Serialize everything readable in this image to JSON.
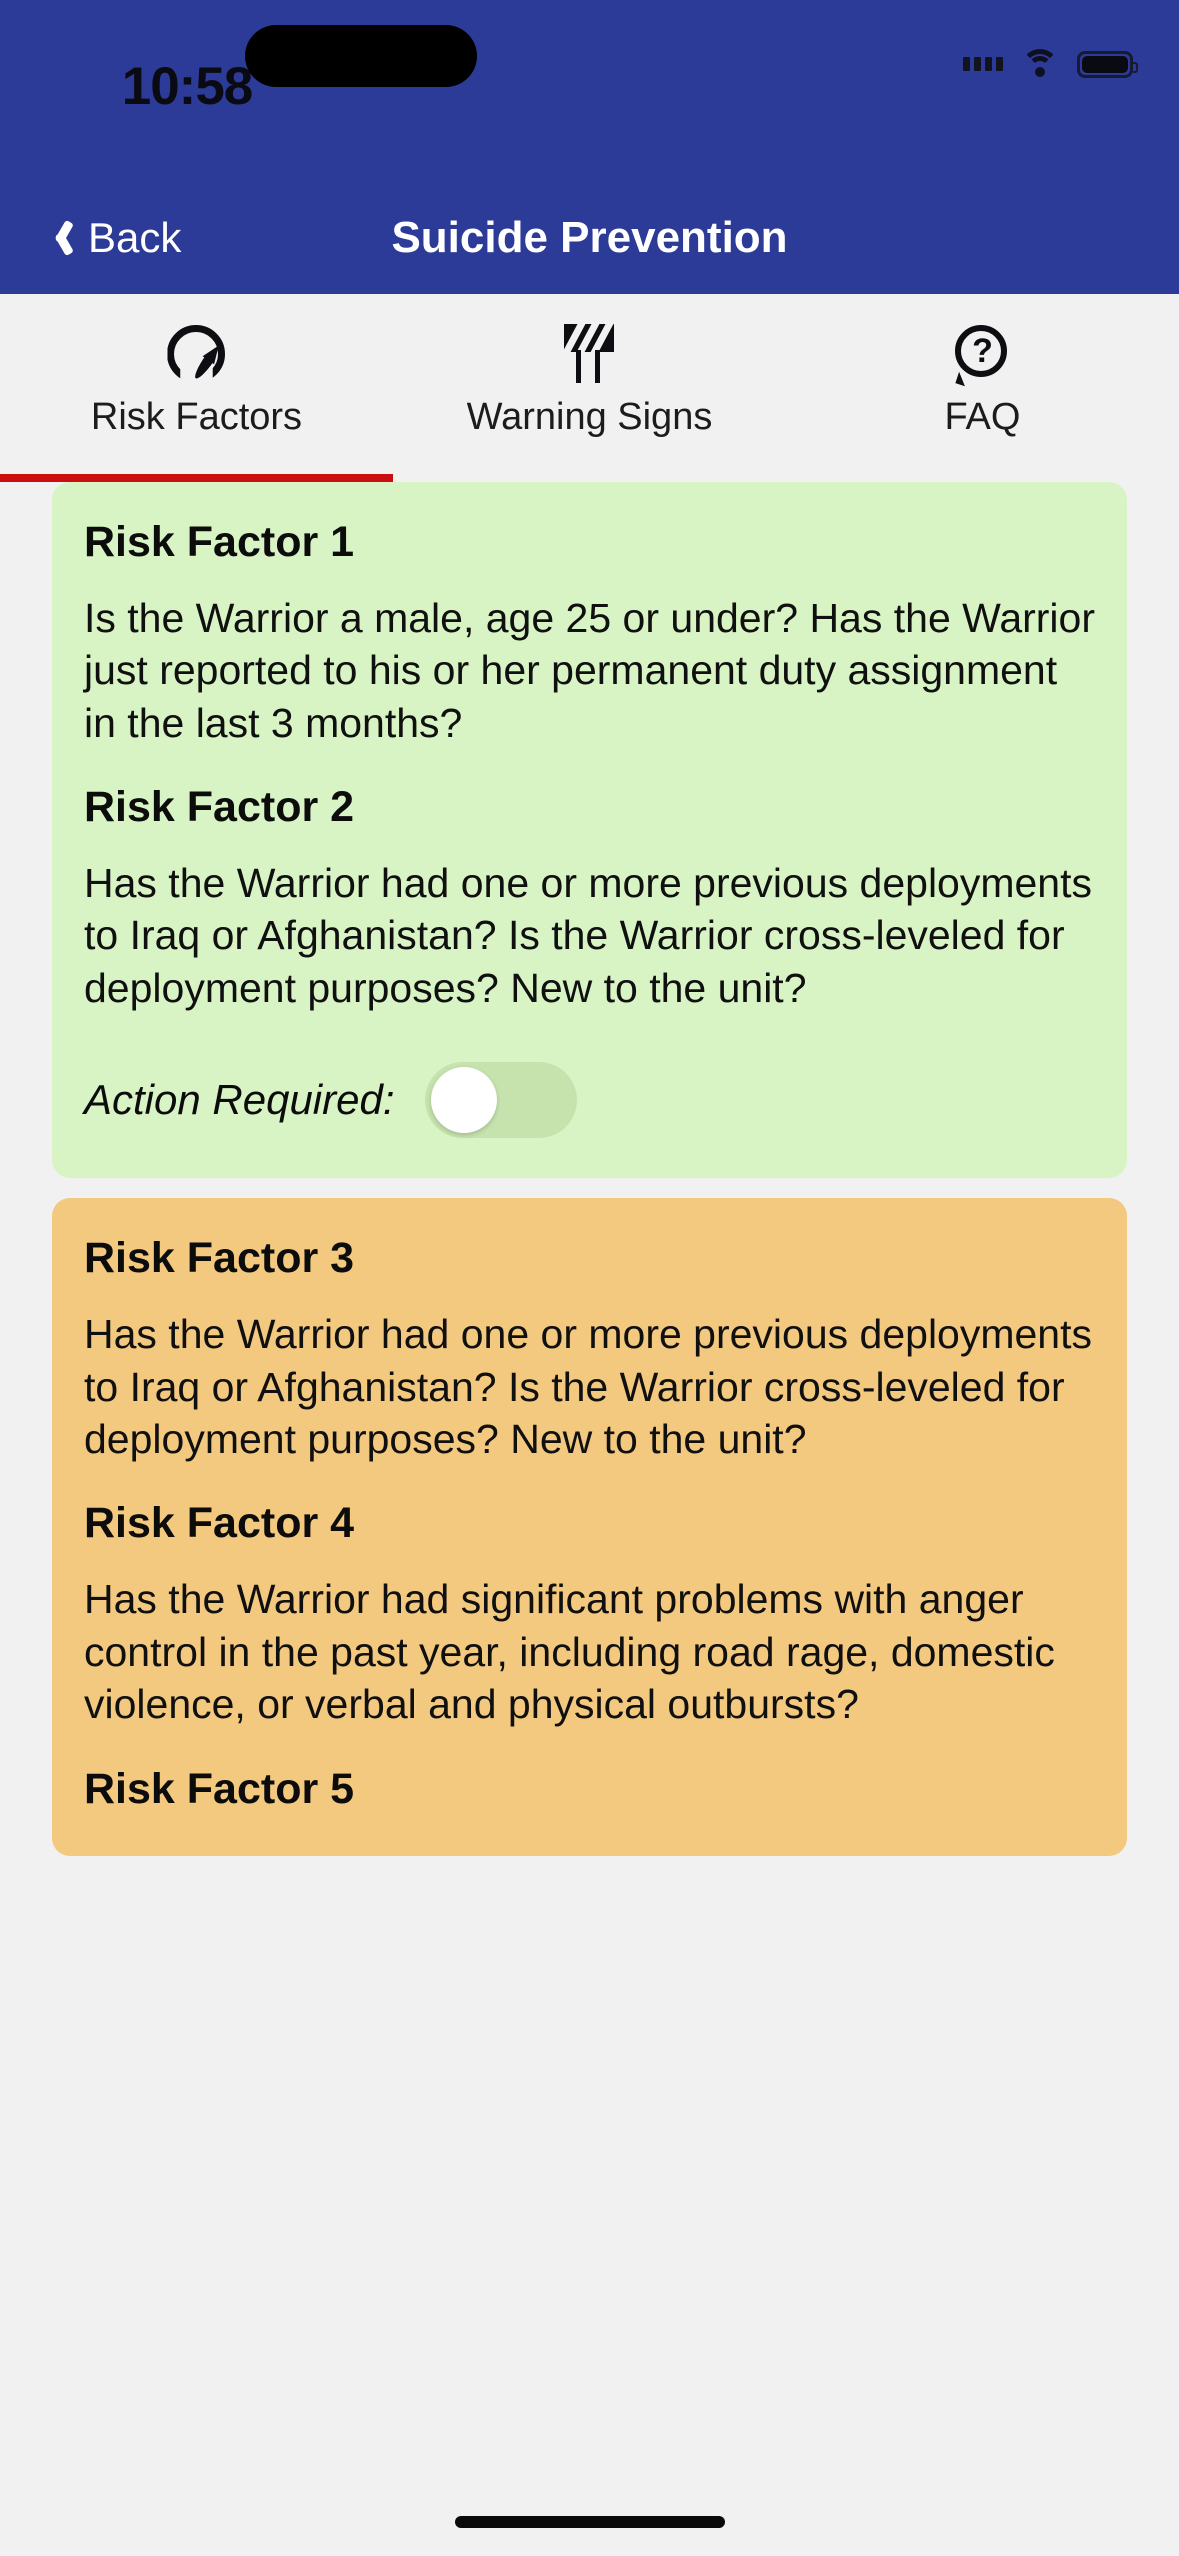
{
  "status_bar": {
    "time": "10:58",
    "icons": [
      "signal-dots-icon",
      "wifi-icon",
      "battery-icon"
    ]
  },
  "nav_bar": {
    "back_label": "Back",
    "back_icon": "chevron-left-icon",
    "title": "Suicide Prevention",
    "background": "#2D3B98"
  },
  "tabs": [
    {
      "label": "Risk Factors",
      "icon": "gauge-icon",
      "active": true
    },
    {
      "label": "Warning Signs",
      "icon": "barricade-icon",
      "active": false
    },
    {
      "label": "FAQ",
      "icon": "question-bubble-icon",
      "active": false
    }
  ],
  "tab_indicator_color": "#CB0D0D",
  "cards": [
    {
      "color": "#D8F4C4",
      "blocks": [
        {
          "type": "title",
          "text": "Risk Factor 1"
        },
        {
          "type": "body",
          "text": "Is the Warrior a male, age 25 or under? Has the Warrior just reported to his or her permanent duty assignment in the last 3 months?"
        },
        {
          "type": "title",
          "text": "Risk Factor 2"
        },
        {
          "type": "body",
          "text": "Has the Warrior had one or more previous deployments to Iraq or Afghanistan? Is the Warrior cross-leveled for deployment purposes? New to the unit?"
        }
      ],
      "action": {
        "label": "Action Required:",
        "toggle_on": false
      }
    },
    {
      "color": "#F3C87F",
      "blocks": [
        {
          "type": "title",
          "text": "Risk Factor 3"
        },
        {
          "type": "body",
          "text": "Has the Warrior had one or more previous deployments to Iraq or Afghanistan? Is the Warrior cross-leveled for deployment purposes? New to the unit?"
        },
        {
          "type": "title",
          "text": "Risk Factor 4"
        },
        {
          "type": "body",
          "text": "Has the Warrior had significant problems with anger control in the past year, including road rage, domestic violence, or verbal and physical outbursts?"
        },
        {
          "type": "title",
          "text": "Risk Factor 5"
        }
      ],
      "action": null
    }
  ],
  "faq_icon_glyph": "?"
}
